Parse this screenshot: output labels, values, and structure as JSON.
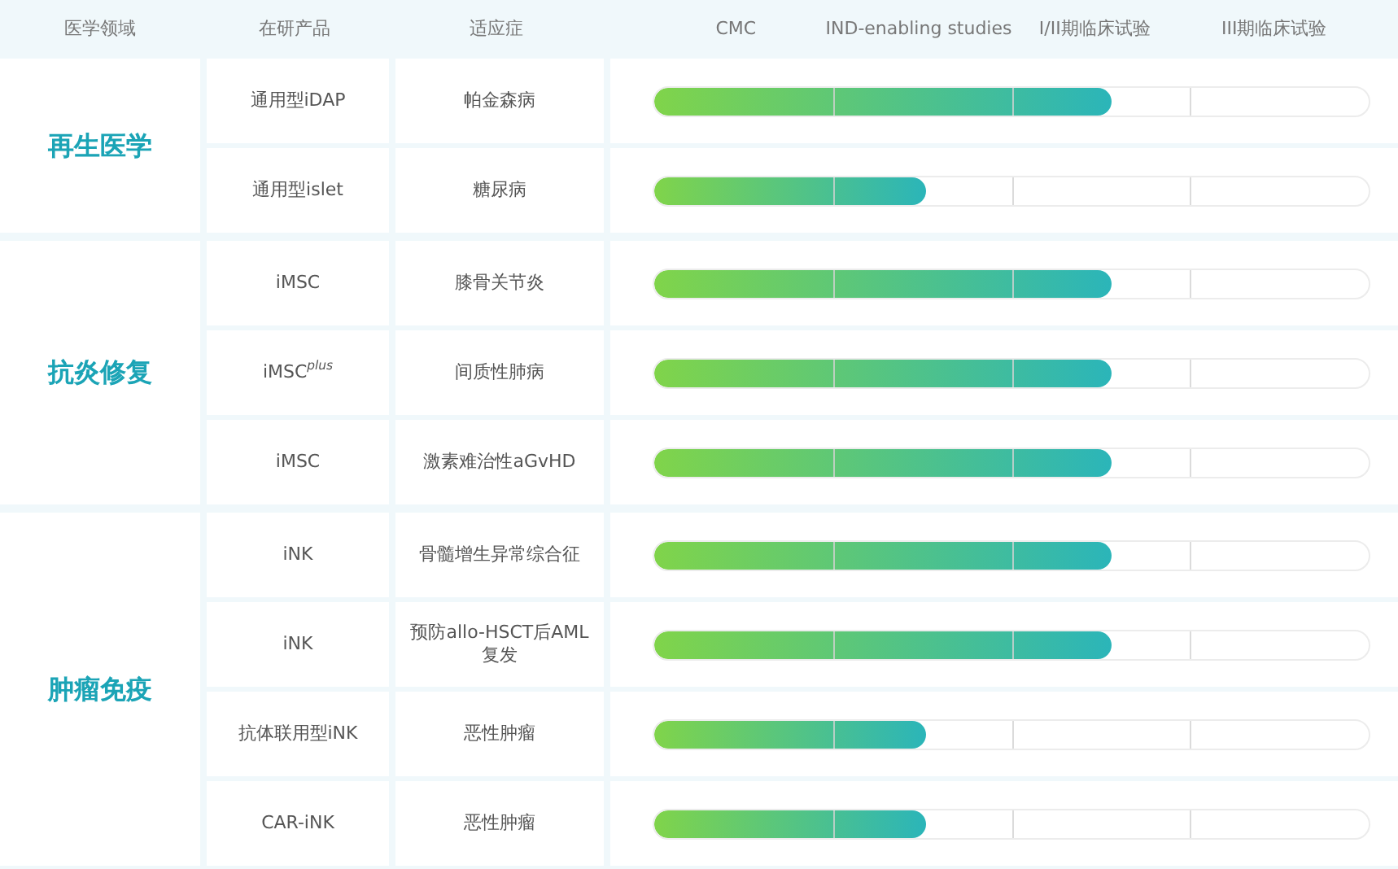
{
  "columns": [
    "医学领域",
    "在研产品",
    "适应症",
    "CMC",
    "IND-enabling studies",
    "I/II期临床试验",
    "III期临床试验"
  ],
  "groups": [
    {
      "area": "再生医学",
      "rows": [
        {
          "product": "通用型iDAP",
          "indication": "帕金森病",
          "level": 0.64
        },
        {
          "product": "通用型islet",
          "indication": "糖尿病",
          "level": 0.38
        }
      ]
    },
    {
      "area": "抗炎修复",
      "rows": [
        {
          "product": "iMSC",
          "indication": "膝骨关节炎",
          "level": 0.64
        },
        {
          "product": "iMSC$^{plus}$",
          "indication": "间质性肺病",
          "level": 0.64
        },
        {
          "product": "iMSC",
          "indication": "激素难治性aGvHD",
          "level": 0.64
        }
      ]
    },
    {
      "area": "肿瘤免疫",
      "rows": [
        {
          "product": "iNK",
          "indication": "骨髓增生异常综合征",
          "level": 0.64
        },
        {
          "product": "iNK",
          "indication": "预防allo-HSCT后AML复发",
          "level": 0.64
        },
        {
          "product": "抗体联用型iNK",
          "indication": "恶性肿瘤",
          "level": 0.38
        },
        {
          "product": "CAR-iNK",
          "indication": "恶性肿瘤",
          "level": 0.38
        }
      ]
    }
  ]
}
